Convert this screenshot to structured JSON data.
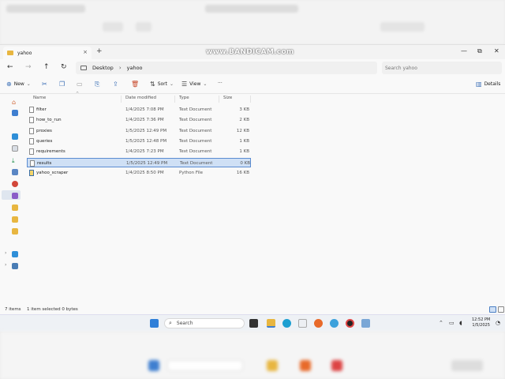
{
  "watermark": "www.BANDICAM.com",
  "tab": {
    "title": "yahoo",
    "close": "×",
    "new": "+"
  },
  "window_controls": {
    "minimize": "—",
    "restore": "⧉",
    "close": "✕"
  },
  "nav": {
    "back": "←",
    "forward": "→",
    "up": "↑",
    "refresh": "↻"
  },
  "address": {
    "crumbs": [
      "Desktop",
      "yahoo"
    ],
    "separator": "›"
  },
  "search": {
    "placeholder": "Search yahoo"
  },
  "toolbar": {
    "new_label": "New",
    "sort_label": "Sort",
    "view_label": "View",
    "more_label": "···",
    "details_label": "Details"
  },
  "columns": {
    "name": "Name",
    "date": "Date modified",
    "type": "Type",
    "size": "Size"
  },
  "files": [
    {
      "name": "filter",
      "date": "1/4/2025 7:08 PM",
      "type": "Text Document",
      "size": "3 KB",
      "selected": false,
      "kind": "txt"
    },
    {
      "name": "how_to_run",
      "date": "1/4/2025 7:36 PM",
      "type": "Text Document",
      "size": "2 KB",
      "selected": false,
      "kind": "txt"
    },
    {
      "name": "proxies",
      "date": "1/5/2025 12:49 PM",
      "type": "Text Document",
      "size": "12 KB",
      "selected": false,
      "kind": "txt"
    },
    {
      "name": "queries",
      "date": "1/5/2025 12:48 PM",
      "type": "Text Document",
      "size": "1 KB",
      "selected": false,
      "kind": "txt"
    },
    {
      "name": "requirements",
      "date": "1/4/2025 7:23 PM",
      "type": "Text Document",
      "size": "1 KB",
      "selected": false,
      "kind": "txt"
    },
    {
      "name": "results",
      "date": "1/5/2025 12:49 PM",
      "type": "Text Document",
      "size": "0 KB",
      "selected": true,
      "kind": "txt"
    },
    {
      "name": "yahoo_scraper",
      "date": "1/4/2025 8:50 PM",
      "type": "Python File",
      "size": "16 KB",
      "selected": false,
      "kind": "py"
    }
  ],
  "status": {
    "items": "7 items",
    "selection": "1 item selected  0 bytes"
  },
  "taskbar": {
    "search_label": "Search",
    "time": "12:52 PM",
    "date": "1/5/2025"
  },
  "colors": {
    "accent": "#5b8cd1",
    "folder": "#e8b640",
    "selection": "#cfe0f5"
  }
}
